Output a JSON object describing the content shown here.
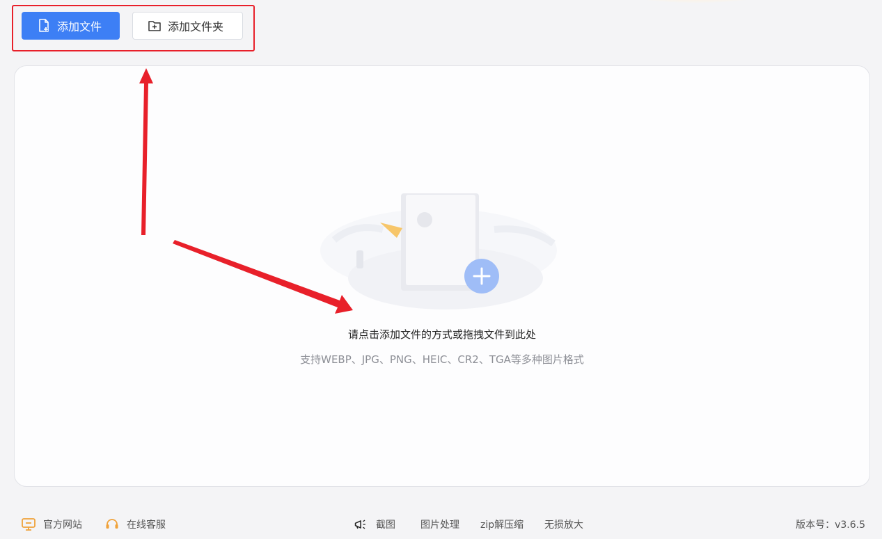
{
  "toolbar": {
    "add_file_label": "添加文件",
    "add_folder_label": "添加文件夹"
  },
  "drop_zone": {
    "hint": "请点击添加文件的方式或拖拽文件到此处",
    "supported_formats": "支持WEBP、JPG、PNG、HEIC、CR2、TGA等多种图片格式"
  },
  "footer": {
    "official_site": "官方网站",
    "online_service": "在线客服",
    "screenshot": "截图",
    "image_processing": "图片处理",
    "zip_tool": "zip解压缩",
    "lossless_zoom": "无损放大",
    "version": "版本号：v3.6.5"
  },
  "colors": {
    "accent": "#3d7ff5",
    "annotation_red": "#e8202a",
    "icon_orange": "#f0a23a"
  },
  "icons": {
    "add_file": "file-plus-icon",
    "add_folder": "folder-plus-icon",
    "official_site": "monitor-icon",
    "online_service": "headset-icon",
    "screenshot": "megaphone-icon"
  }
}
